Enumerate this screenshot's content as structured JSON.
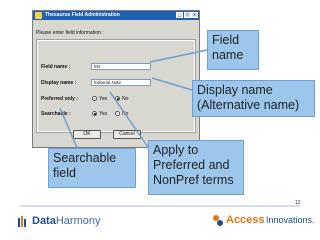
{
  "dialog": {
    "title": "Thesaurus Field Administration",
    "instruction": "Please enter field information :",
    "field_name_label": "Field name :",
    "field_name_value": "EN",
    "display_name_label": "Display name :",
    "display_name_value": "Editorial Note",
    "preferred_only_label": "Preferred only :",
    "searchable_label": "Searchable :",
    "yes_label": "Yes",
    "no_label": "No",
    "preferred_only_selected": "No",
    "searchable_selected": "Yes",
    "ok_label": "OK",
    "cancel_label": "Cancel"
  },
  "callouts": {
    "field_name": "Field name",
    "display_name": "Display name (Alternative name)",
    "apply_to": "Apply to Preferred and NonPref terms",
    "searchable": "Searchable field"
  },
  "footer": {
    "data_harmony_1": "Data",
    "data_harmony_2": "Harmony",
    "access_1": "Access",
    "access_2": "Innovations.",
    "page_number": "12"
  },
  "colors": {
    "callout_fill": "#9cc6ec",
    "titlebar": "#1f5fb0",
    "brand_blue": "#1d4f8f",
    "brand_orange": "#e07a10"
  }
}
